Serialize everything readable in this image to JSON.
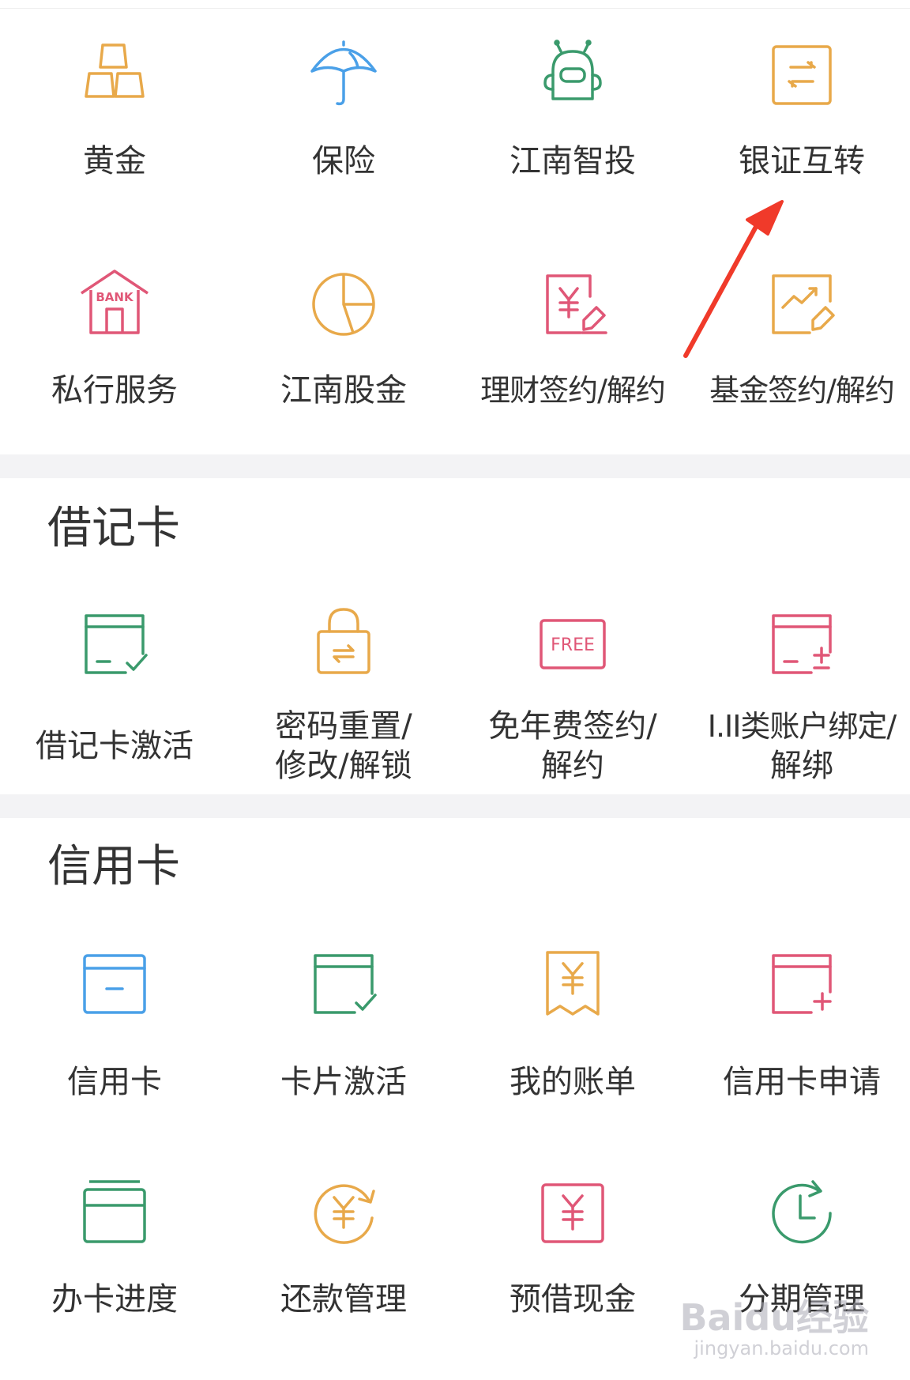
{
  "colors": {
    "gold": "#e8a94a",
    "blue": "#4aa0e8",
    "green": "#3a9a6c",
    "pink": "#e05777",
    "arrow": "#f03a2a",
    "divider": "#f3f3f5"
  },
  "wealth": {
    "items": [
      {
        "label": "黄金",
        "icon": "gold-bars-icon"
      },
      {
        "label": "保险",
        "icon": "umbrella-icon"
      },
      {
        "label": "江南智投",
        "icon": "robot-icon"
      },
      {
        "label": "银证互转",
        "icon": "transfer-icon"
      },
      {
        "label": "私行服务",
        "icon": "bank-building-icon"
      },
      {
        "label": "江南股金",
        "icon": "pie-chart-icon"
      },
      {
        "label": "理财签约/解约",
        "icon": "yuan-contract-icon"
      },
      {
        "label": "基金签约/解约",
        "icon": "fund-contract-icon"
      }
    ]
  },
  "debit": {
    "title": "借记卡",
    "items": [
      {
        "label": "借记卡激活",
        "icon": "card-check-icon"
      },
      {
        "label": "密码重置/",
        "label2": "修改/解锁",
        "icon": "padlock-icon"
      },
      {
        "label": "免年费签约/",
        "label2": "解约",
        "icon": "free-badge-icon",
        "badge": "FREE"
      },
      {
        "label": "I.II类账户绑定/",
        "label2": "解绑",
        "icon": "card-plus-minus-icon"
      }
    ]
  },
  "credit": {
    "title": "信用卡",
    "items": [
      {
        "label": "信用卡",
        "icon": "credit-card-icon"
      },
      {
        "label": "卡片激活",
        "icon": "card-activate-icon"
      },
      {
        "label": "我的账单",
        "icon": "bill-icon"
      },
      {
        "label": "信用卡申请",
        "icon": "card-apply-icon"
      },
      {
        "label": "办卡进度",
        "icon": "card-progress-icon"
      },
      {
        "label": "还款管理",
        "icon": "repayment-icon"
      },
      {
        "label": "预借现金",
        "icon": "cash-advance-icon"
      },
      {
        "label": "分期管理",
        "icon": "clock-icon"
      }
    ]
  },
  "watermark": {
    "main": "Baidu经验",
    "sub": "jingyan.baidu.com"
  }
}
